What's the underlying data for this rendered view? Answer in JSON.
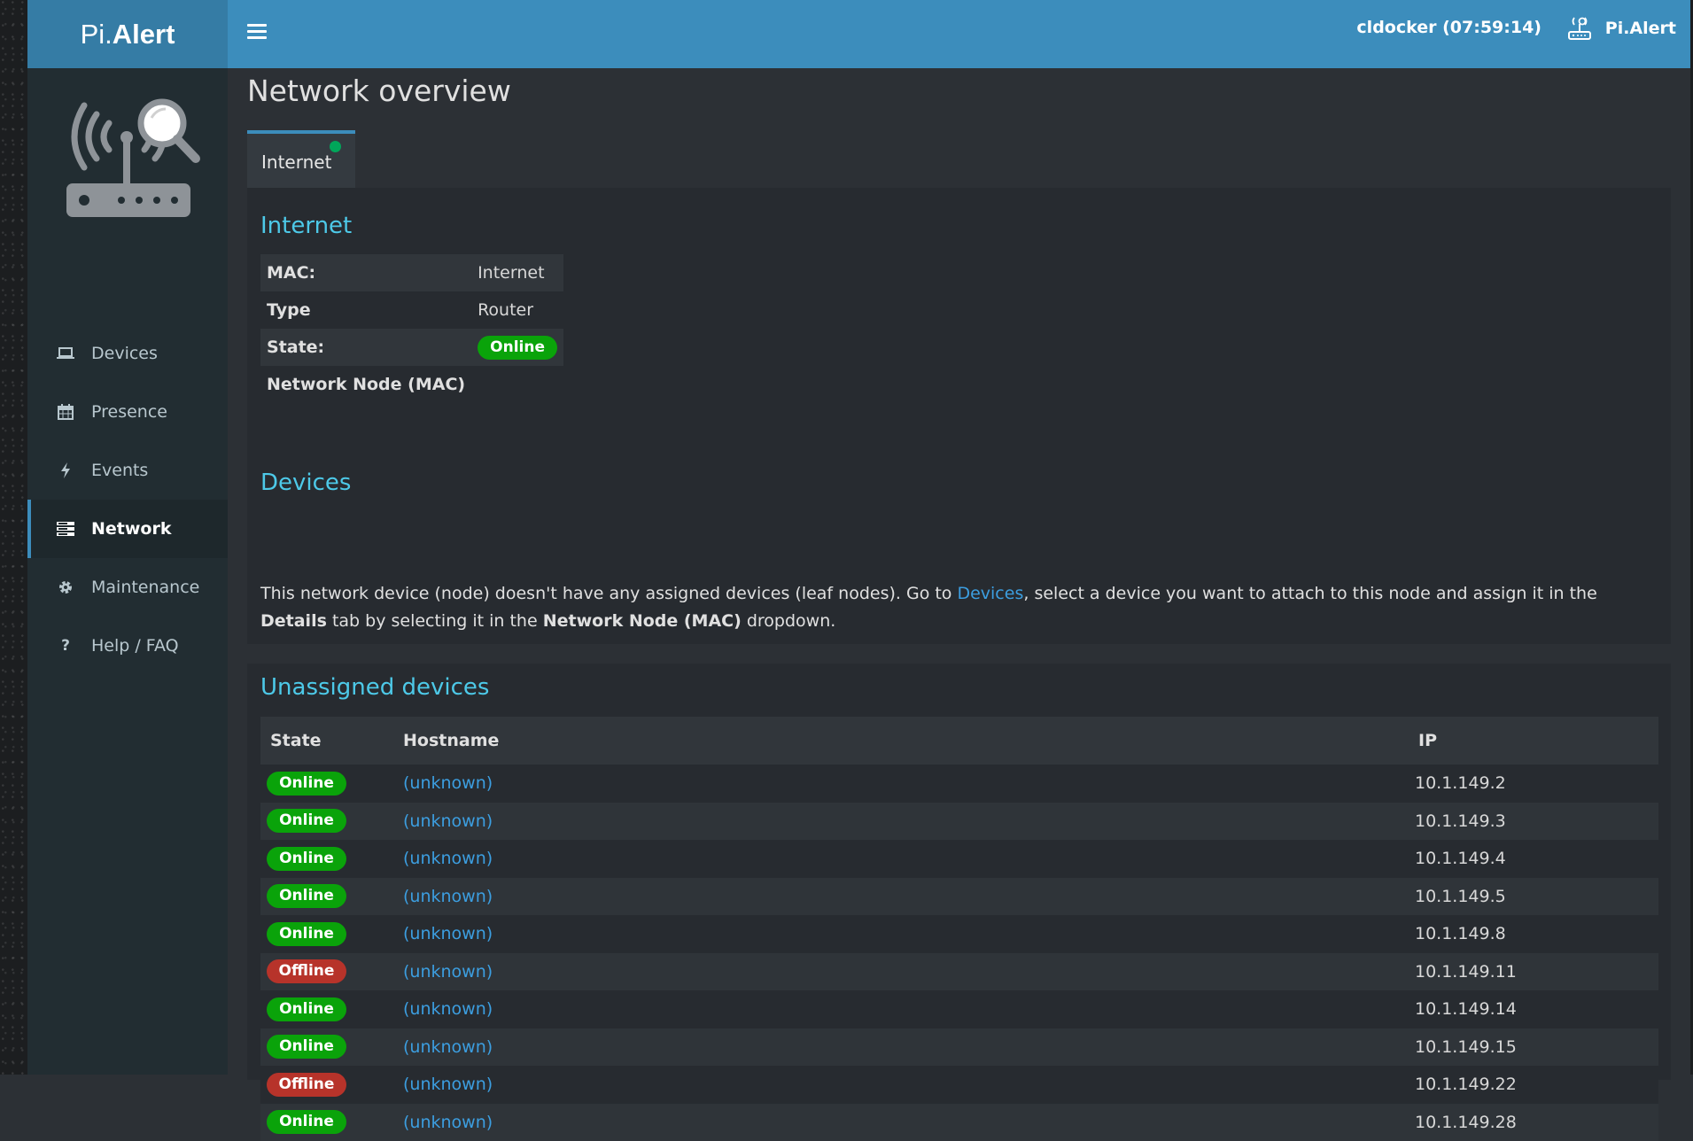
{
  "app": {
    "logo_prefix": "Pi.",
    "logo_name": "Alert",
    "user_session": "cldocker (07:59:14)",
    "brand": "Pi.Alert"
  },
  "sidebar": {
    "items": [
      {
        "label": "Devices",
        "icon": "laptop-icon"
      },
      {
        "label": "Presence",
        "icon": "calendar-icon"
      },
      {
        "label": "Events",
        "icon": "bolt-icon"
      },
      {
        "label": "Network",
        "icon": "server-icon"
      },
      {
        "label": "Maintenance",
        "icon": "gear-icon"
      },
      {
        "label": "Help / FAQ",
        "icon": "question-icon"
      }
    ],
    "active_index": 3
  },
  "page": {
    "title": "Network overview",
    "tab_label": "Internet"
  },
  "node": {
    "title": "Internet",
    "rows": [
      {
        "label": "MAC:",
        "value": "Internet"
      },
      {
        "label": "Type",
        "value": "Router"
      },
      {
        "label": "State:",
        "value": "Online"
      },
      {
        "label": "Network Node (MAC)",
        "value": ""
      }
    ]
  },
  "devices_section": {
    "title": "Devices",
    "text_1": "This network device (node) doesn't have any assigned devices (leaf nodes). Go to ",
    "link": "Devices",
    "text_2": ", select a device you want to attach to this node and assign it in the ",
    "bold_1": "Details",
    "text_3": " tab by selecting it in the ",
    "bold_2": "Network Node (MAC)",
    "text_4": " dropdown."
  },
  "unassigned": {
    "title": "Unassigned devices",
    "columns": [
      "State",
      "Hostname",
      "IP"
    ],
    "rows": [
      {
        "state": "Online",
        "hostname": "(unknown)",
        "ip": "10.1.149.2"
      },
      {
        "state": "Online",
        "hostname": "(unknown)",
        "ip": "10.1.149.3"
      },
      {
        "state": "Online",
        "hostname": "(unknown)",
        "ip": "10.1.149.4"
      },
      {
        "state": "Online",
        "hostname": "(unknown)",
        "ip": "10.1.149.5"
      },
      {
        "state": "Online",
        "hostname": "(unknown)",
        "ip": "10.1.149.8"
      },
      {
        "state": "Offline",
        "hostname": "(unknown)",
        "ip": "10.1.149.11"
      },
      {
        "state": "Online",
        "hostname": "(unknown)",
        "ip": "10.1.149.14"
      },
      {
        "state": "Online",
        "hostname": "(unknown)",
        "ip": "10.1.149.15"
      },
      {
        "state": "Offline",
        "hostname": "(unknown)",
        "ip": "10.1.149.22"
      },
      {
        "state": "Online",
        "hostname": "(unknown)",
        "ip": "10.1.149.28"
      }
    ]
  },
  "colors": {
    "header": "#3c8dbc",
    "logo_bg": "#357ca5",
    "sidebar": "#222d32",
    "online": "#0aa30a",
    "offline": "#b7332a",
    "link": "#3c9ee0",
    "section_title": "#4dc9e8"
  }
}
